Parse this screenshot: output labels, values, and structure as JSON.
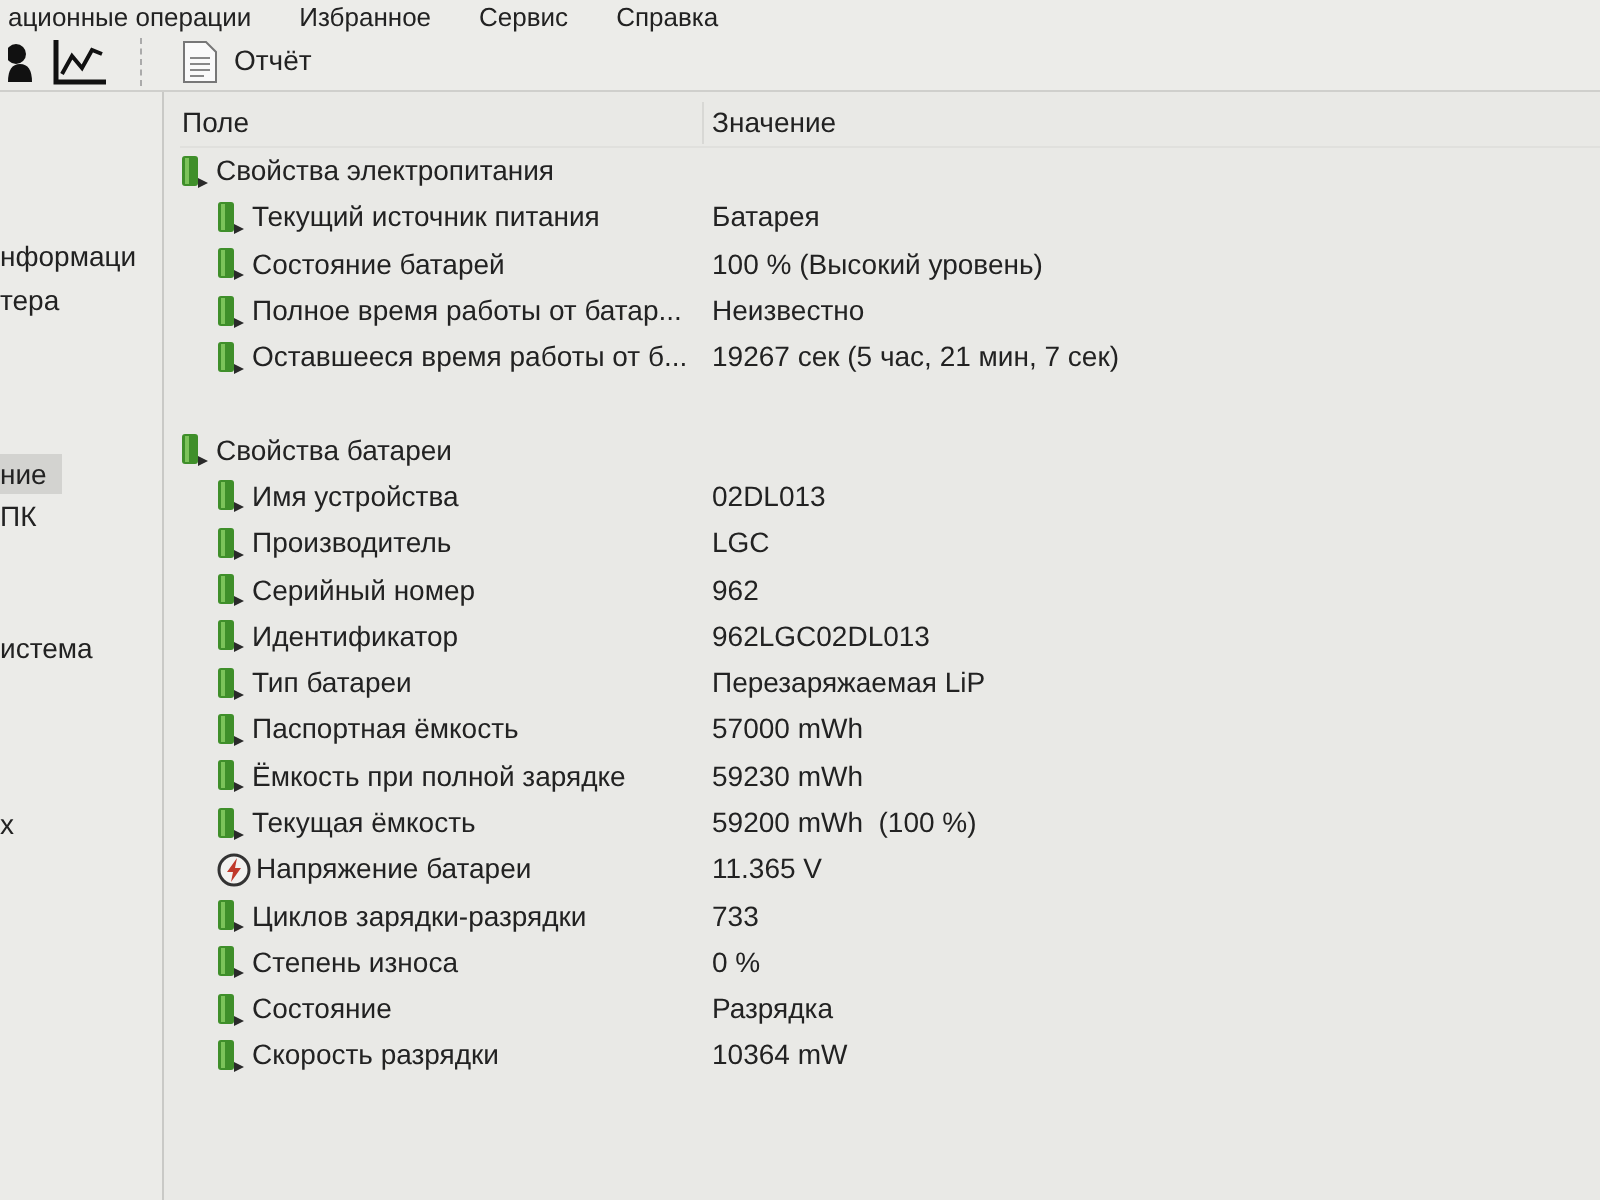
{
  "menu": [
    "ационные операции",
    "Избранное",
    "Сервис",
    "Справка"
  ],
  "toolbar": {
    "report_button": "Отчёт"
  },
  "sidebar": {
    "items": [
      {
        "label": "нформаци",
        "selected": false
      },
      {
        "label": "тера",
        "selected": false
      },
      {
        "label": "ние",
        "selected": true
      },
      {
        "label": "ПК",
        "selected": false
      },
      {
        "label": "истема",
        "selected": false
      },
      {
        "label": "х",
        "selected": false
      }
    ]
  },
  "table": {
    "columns": [
      "Поле",
      "Значение"
    ],
    "sections": [
      {
        "title": "Свойства электропитания",
        "rows": [
          {
            "kind": "battery",
            "field": "Текущий источник питания",
            "value": "Батарея"
          },
          {
            "kind": "battery",
            "field": "Состояние батарей",
            "value": "100 % (Высокий уровень)"
          },
          {
            "kind": "battery",
            "field": "Полное время работы от батар...",
            "value": "Неизвестно"
          },
          {
            "kind": "battery",
            "field": "Оставшееся время работы от б...",
            "value": "19267 сек (5 час, 21 мин, 7 сек)"
          }
        ]
      },
      {
        "title": "Свойства батареи",
        "rows": [
          {
            "kind": "battery",
            "field": "Имя устройства",
            "value": "02DL013"
          },
          {
            "kind": "battery",
            "field": "Производитель",
            "value": "LGC"
          },
          {
            "kind": "battery",
            "field": "Серийный номер",
            "value": "962"
          },
          {
            "kind": "battery",
            "field": "Идентификатор",
            "value": "962LGC02DL013"
          },
          {
            "kind": "battery",
            "field": "Тип батареи",
            "value": "Перезаряжаемая LiP"
          },
          {
            "kind": "battery",
            "field": "Паспортная ёмкость",
            "value": "57000 mWh"
          },
          {
            "kind": "battery",
            "field": "Ёмкость при полной зарядке",
            "value": "59230 mWh"
          },
          {
            "kind": "battery",
            "field": "Текущая ёмкость",
            "value": "59200 mWh  (100 %)"
          },
          {
            "kind": "voltage",
            "field": "Напряжение батареи",
            "value": "11.365 V"
          },
          {
            "kind": "battery",
            "field": "Циклов зарядки-разрядки",
            "value": "733"
          },
          {
            "kind": "battery",
            "field": "Степень износа",
            "value": "0 %"
          },
          {
            "kind": "battery",
            "field": "Состояние",
            "value": "Разрядка"
          },
          {
            "kind": "battery",
            "field": "Скорость разрядки",
            "value": "10364 mW"
          }
        ]
      }
    ]
  }
}
